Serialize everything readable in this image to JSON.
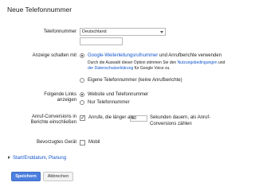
{
  "dialog": {
    "title": "Neue Telefonnummer",
    "phone": {
      "label": "Telefonnummer",
      "country_value": "Deutschland",
      "number_value": ""
    },
    "display_as": {
      "label": "Anzeige schalten mit",
      "option1_link": "Google-Weiterleitungsrufnummer",
      "option1_suffix": " und Anrufberichte verwenden",
      "desc_line1_prefix": "Durch die Auswahl dieser Option stimmen Sie den ",
      "desc_line1_link": "Nutzungsbedingungen",
      "desc_line1_suffix": " und",
      "desc_line2_link": "der Datenschutzerklärung",
      "desc_line2_suffix": " für Google Voice zu.",
      "option2": "Eigene Telefonnummer (keine Anrufberichte)"
    },
    "links": {
      "label_line1": "Folgende Links",
      "label_line2": "anzeigen",
      "option1": "Website und Telefonnummer",
      "option2": "Nur Telefonnummer"
    },
    "conversions": {
      "label_line1": "Anruf-Conversions in",
      "label_line2": "Berichte einschließen",
      "text_before": "Anrufe, die länger als",
      "seconds_value": "60",
      "text_after": "Sekunden dauern, als Anruf-",
      "text_line2": "Conversions zählen"
    },
    "device": {
      "label": "Bevorzugtes Gerät",
      "option": "Mobil"
    },
    "schedule_link": "Start/Enddatum, Planung",
    "save_button": "Speichern",
    "cancel_button": "Abbrechen"
  },
  "colors": {
    "link": "#1155cc",
    "primary_button": "#4d7fe0"
  }
}
